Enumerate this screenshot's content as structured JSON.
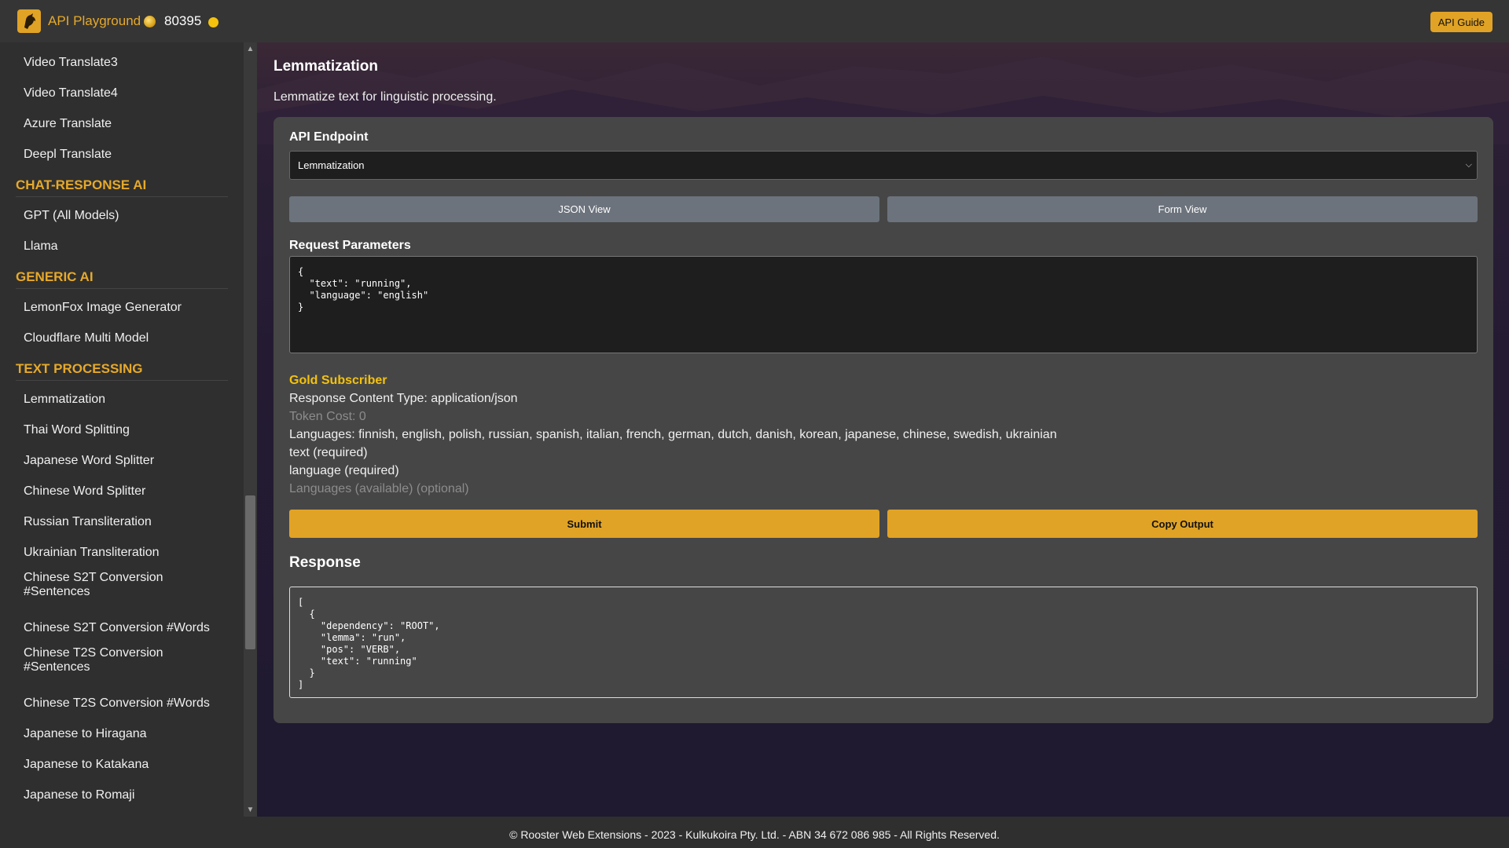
{
  "header": {
    "app_title": "API Playground",
    "token_count": "80395",
    "api_guide_label": "API Guide"
  },
  "sidebar": {
    "items_top": [
      "Video Translate3",
      "Video Translate4",
      "Azure Translate",
      "Deepl Translate"
    ],
    "section_chat": "CHAT-RESPONSE AI",
    "items_chat": [
      "GPT (All Models)",
      "Llama"
    ],
    "section_generic": "GENERIC AI",
    "items_generic": [
      "LemonFox Image Generator",
      "Cloudflare Multi Model"
    ],
    "section_text": "TEXT PROCESSING",
    "items_text": [
      "Lemmatization",
      "Thai Word Splitting",
      "Japanese Word Splitter",
      "Chinese Word Splitter",
      "Russian Transliteration",
      "Ukrainian Transliteration",
      "Chinese S2T Conversion #Sentences",
      "Chinese S2T Conversion #Words",
      "Chinese T2S Conversion #Sentences",
      "Chinese T2S Conversion #Words",
      "Japanese to Hiragana",
      "Japanese to Katakana",
      "Japanese to Romaji"
    ]
  },
  "main": {
    "title": "Lemmatization",
    "description": "Lemmatize text for linguistic processing.",
    "endpoint_label": "API Endpoint",
    "endpoint_value": "Lemmatization",
    "json_view_label": "JSON View",
    "form_view_label": "Form View",
    "request_label": "Request Parameters",
    "request_body": "{\n  \"text\": \"running\",\n  \"language\": \"english\"\n}",
    "subscriber": "Gold Subscriber",
    "content_type": "Response Content Type: application/json",
    "token_cost": "Token Cost: 0",
    "languages": "Languages: finnish, english, polish, russian, spanish, italian, french, german, dutch, danish, korean, japanese, chinese, swedish, ukrainian",
    "param_text": "text (required)",
    "param_language": "language (required)",
    "param_languages": "Languages (available) (optional)",
    "submit_label": "Submit",
    "copy_label": "Copy Output",
    "response_title": "Response",
    "response_body": "[\n  {\n    \"dependency\": \"ROOT\",\n    \"lemma\": \"run\",\n    \"pos\": \"VERB\",\n    \"text\": \"running\"\n  }\n]"
  },
  "footer": {
    "text": "© Rooster Web Extensions - 2023 - Kulkukoira Pty. Ltd. - ABN 34 672 086 985 - All Rights Reserved."
  },
  "colors": {
    "accent": "#e1a325",
    "gold_text": "#f4c20d",
    "button_gray": "#6c737c",
    "card_bg": "#464646"
  }
}
